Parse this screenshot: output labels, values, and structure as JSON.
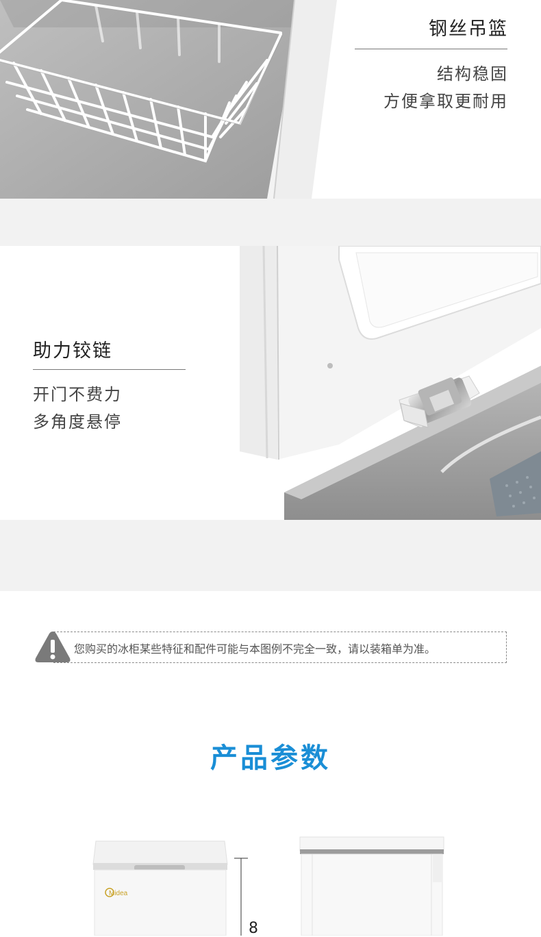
{
  "basket": {
    "title": "钢丝吊篮",
    "desc_line1": "结构稳固",
    "desc_line2": "方便拿取更耐用"
  },
  "hinge": {
    "title": "助力铰链",
    "desc_line1": "开门不费力",
    "desc_line2": "多角度悬停"
  },
  "notice": {
    "icon": "warning-icon",
    "text": "您购买的冰柜某些特征和配件可能与本图例不完全一致，请以装箱单为准。"
  },
  "params": {
    "title": "产品参数"
  },
  "product": {
    "brand_logo": "Midea",
    "dimension_partial": "8"
  },
  "colors": {
    "accent": "#1a8ed6",
    "section_gap": "#f2f2f2",
    "logo_gold": "#c9a227"
  }
}
